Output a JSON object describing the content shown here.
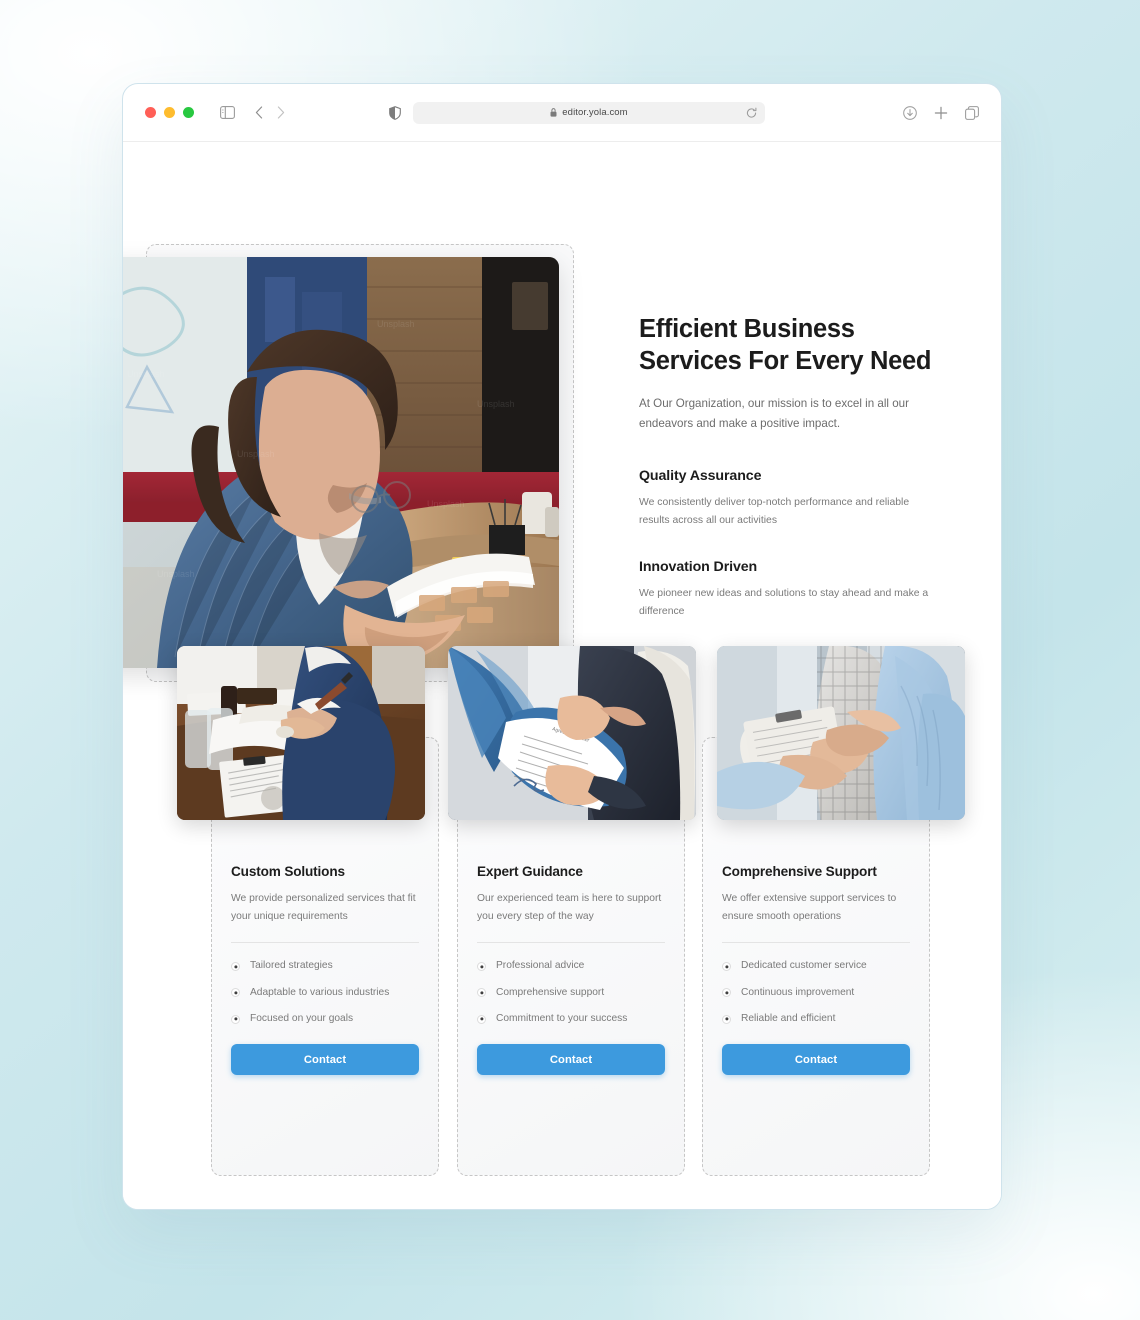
{
  "browser": {
    "traffic_lights": [
      "close",
      "minimize",
      "maximize"
    ],
    "sidebar_toggle": "sidebar-icon",
    "back": "chevron-left-icon",
    "forward": "chevron-right-icon",
    "shield": "shield-icon",
    "lock": "lock-icon",
    "url": "editor.yola.com",
    "reload": "reload-icon",
    "downloads": "download-icon",
    "new_tab": "plus-icon",
    "tab_overview": "tabs-icon"
  },
  "hero": {
    "title": "Efficient Business Services For Every Need",
    "subtitle": "At Our Organization, our mission is to excel in all our endeavors and make a positive impact.",
    "image_alt": "businessman-reviewing-documents-in-meeting-room",
    "features": [
      {
        "title": "Quality Assurance",
        "desc": "We consistently deliver top-notch performance and reliable results across all our activities"
      },
      {
        "title": "Innovation Driven",
        "desc": "We pioneer new ideas and solutions to stay ahead and make a difference"
      }
    ]
  },
  "cards": [
    {
      "title": "Custom Solutions",
      "desc": "We provide personalized services that fit your unique requirements",
      "image_alt": "man-in-blue-suit-writing-at-desk",
      "items": [
        "Tailored strategies",
        "Adaptable to various industries",
        "Focused on your goals"
      ],
      "button": "Contact"
    },
    {
      "title": "Expert Guidance",
      "desc": "Our experienced team is here to support you every step of the way",
      "image_alt": "hands-holding-signed-document-in-blue-folder",
      "items": [
        "Professional advice",
        "Comprehensive support",
        "Commitment to your success"
      ],
      "button": "Contact"
    },
    {
      "title": "Comprehensive Support",
      "desc": "We offer extensive support services to ensure smooth operations",
      "image_alt": "two-people-shaking-hands-with-clipboard",
      "items": [
        "Dedicated customer service",
        "Continuous improvement",
        "Reliable and efficient"
      ],
      "button": "Contact"
    }
  ],
  "colors": {
    "accent": "#3d9ade",
    "page_background": "#ffffff",
    "canvas_background": "#c4e4ea",
    "heading": "#1c1c1c",
    "body_text": "#7a7a7a",
    "traffic_red": "#ff5f57",
    "traffic_yellow": "#febc2e",
    "traffic_green": "#28c840"
  }
}
